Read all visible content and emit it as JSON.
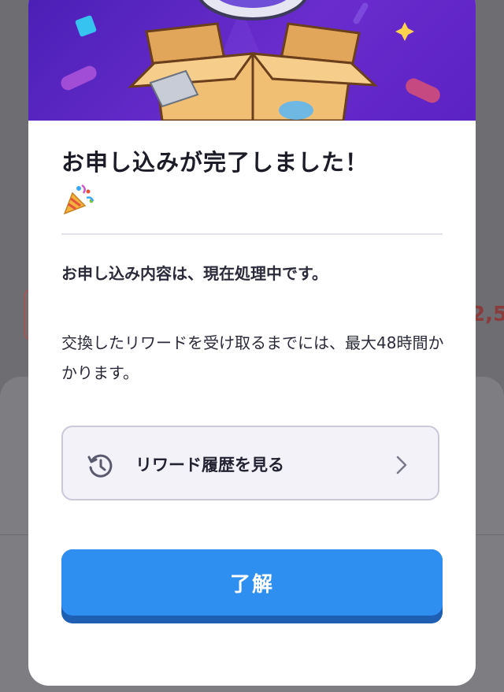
{
  "background": {
    "value_fragment": "2,5"
  },
  "modal": {
    "title": "お申し込みが完了しました！",
    "emoji_icon": "party-popper",
    "processing_text": "お申し込み内容は、現在処理中です。",
    "detail_text": "交換したリワードを受け取るまでには、最大48時間かかります。",
    "history_button": {
      "label": "リワード履歴を見る",
      "icon": "history-clock",
      "trailing_icon": "chevron-right"
    },
    "confirm_button": {
      "label": "了解"
    }
  },
  "colors": {
    "hero_purple": "#5b22c4",
    "primary_blue": "#2f8ff0",
    "history_bg": "#f2f2f8",
    "text_dark": "#1c1c28"
  }
}
